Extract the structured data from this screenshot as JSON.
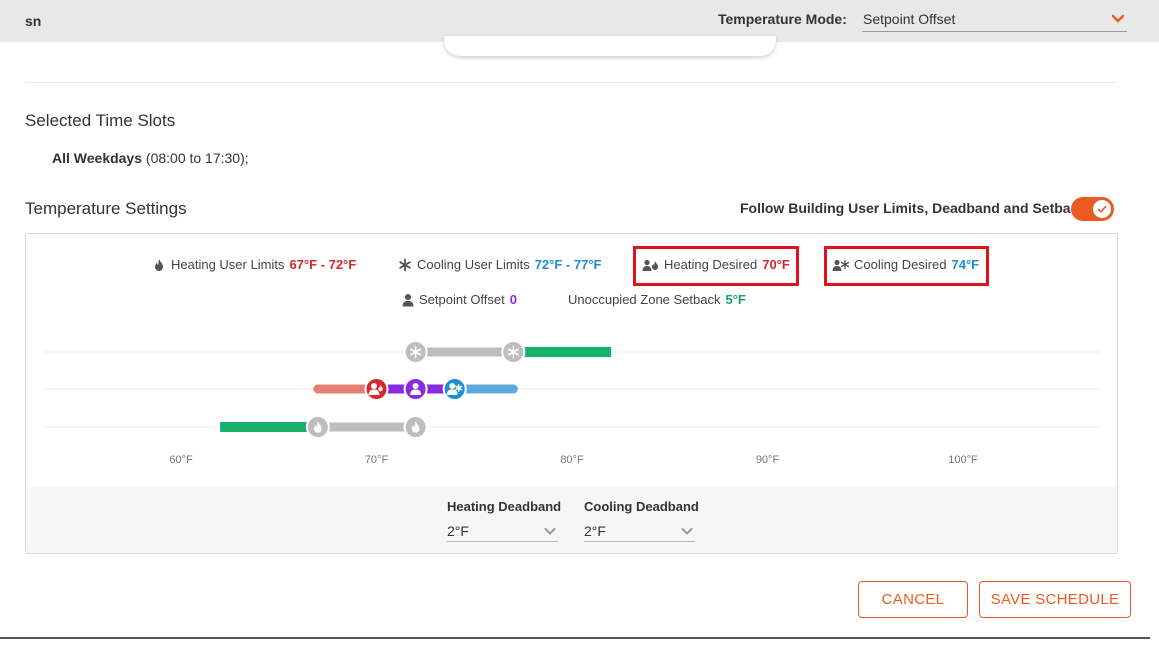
{
  "header": {
    "user": "sn",
    "temperature_mode_label": "Temperature Mode:",
    "temperature_mode_value": "Setpoint Offset"
  },
  "time_slots": {
    "title": "Selected Time Slots",
    "days": "All Weekdays",
    "hours": " (08:00 to 17:30);"
  },
  "temperature_settings": {
    "title": "Temperature Settings",
    "follow_label": "Follow Building User Limits, Deadband and Setback",
    "follow_enabled": true,
    "accent_color": "#ea5a23",
    "legend": {
      "heating_user_limits_label": "Heating User Limits",
      "heating_user_limits_value": "67°F - 72°F",
      "cooling_user_limits_label": "Cooling User Limits",
      "cooling_user_limits_value": "72°F - 77°F",
      "heating_desired_label": "Heating Desired",
      "heating_desired_value": "70°F",
      "cooling_desired_label": "Cooling Desired",
      "cooling_desired_value": "74°F",
      "setpoint_offset_label": "Setpoint Offset",
      "setpoint_offset_value": "0",
      "unoccupied_setback_label": "Unoccupied Zone Setback",
      "unoccupied_setback_value": "5°F"
    },
    "scale_ticks": [
      "60°F",
      "70°F",
      "80°F",
      "90°F",
      "100°F"
    ],
    "scale_domain": [
      60,
      100
    ],
    "cooling_limits": [
      72,
      77
    ],
    "cooling_setback_to": 82,
    "heating_desired": 70,
    "setpoint": 72,
    "cooling_desired": 74,
    "desired_range": [
      67,
      77
    ],
    "heating_limits": [
      67,
      72
    ],
    "heating_setback_from": 62,
    "colors": {
      "heating": "#d7262d",
      "heating_light": "#e57f73",
      "cooling": "#1b8ed6",
      "cooling_light": "#5ea9dd",
      "offset": "#8a2be2",
      "setback": "#18b06a",
      "limit_bar": "#bdbdbd"
    },
    "heating_deadband_label": "Heating Deadband",
    "heating_deadband_value": "2°F",
    "cooling_deadband_label": "Cooling Deadband",
    "cooling_deadband_value": "2°F"
  },
  "actions": {
    "cancel": "CANCEL",
    "save": "SAVE SCHEDULE"
  }
}
